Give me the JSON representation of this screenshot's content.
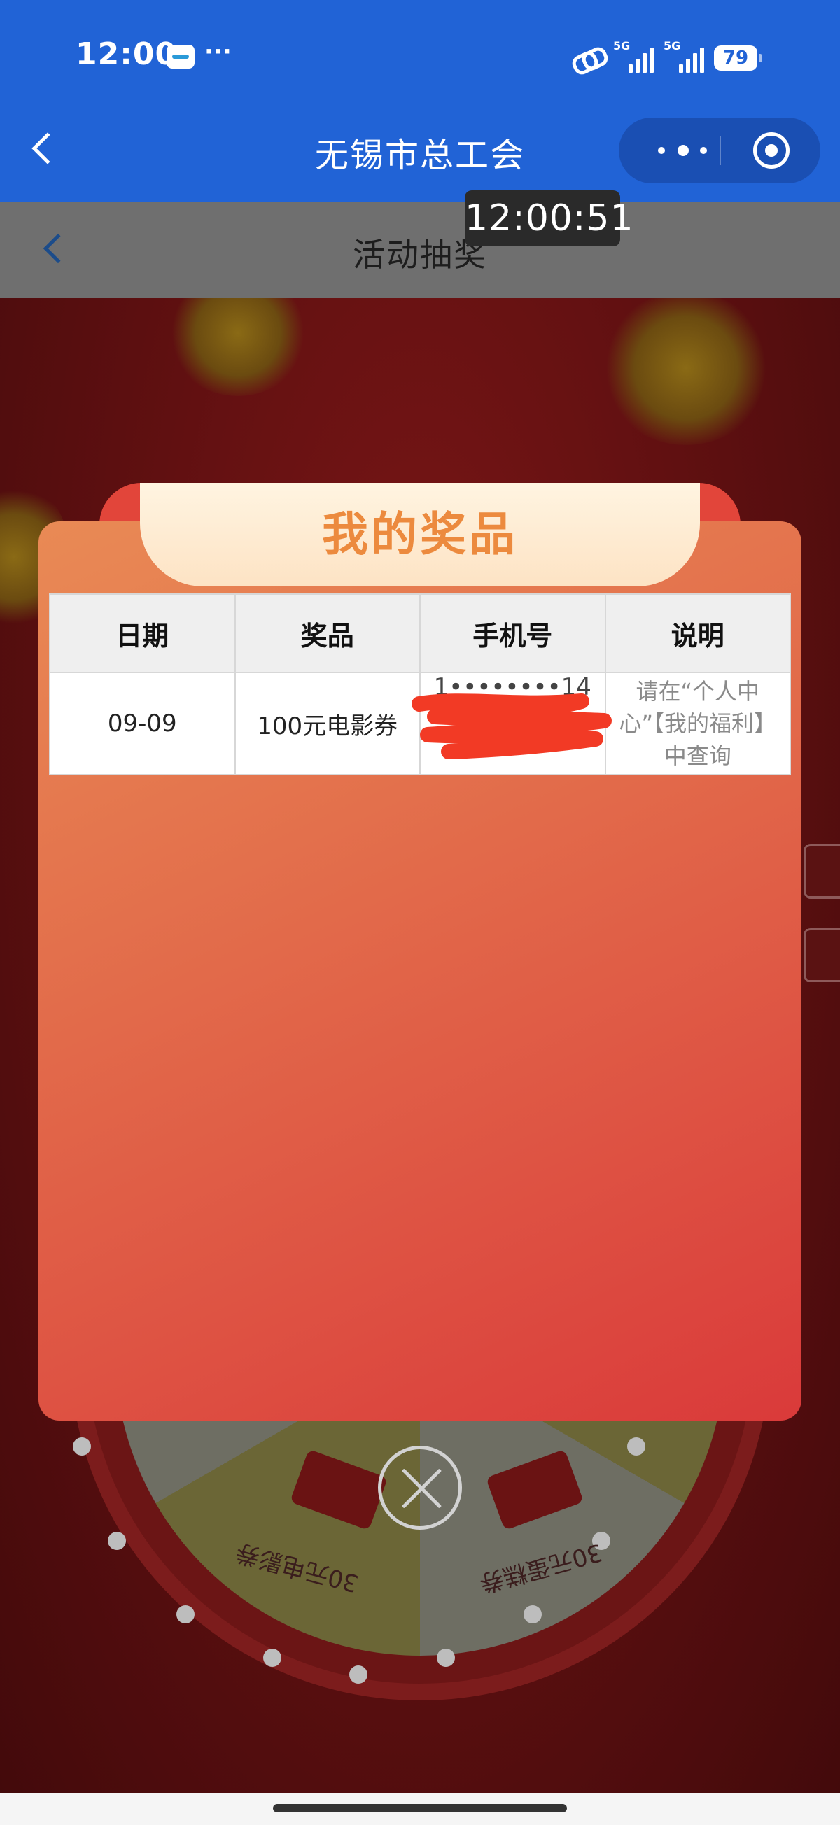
{
  "status_bar": {
    "time": "12:00",
    "dots": "···",
    "network_1": "5G",
    "network_2": "5G",
    "battery": "79"
  },
  "header": {
    "title": "无锡市总工会"
  },
  "page": {
    "title": "活动抽奖",
    "timestamp": "12:00:51"
  },
  "modal": {
    "title": "我的奖品",
    "columns": [
      "日期",
      "奖品",
      "手机号",
      "说明"
    ],
    "rows": [
      {
        "date": "09-09",
        "prize": "100元电影券",
        "phone": "1••••••••14",
        "note": "请在“个人中心”【我的福利】中查询"
      }
    ]
  },
  "wheel": {
    "left_label": "30元电影券",
    "right_label": "30元蛋糕券"
  },
  "colors": {
    "header_blue": "#2163d6",
    "modal_title": "#ec8a3e",
    "redaction_red": "#f23a25"
  }
}
